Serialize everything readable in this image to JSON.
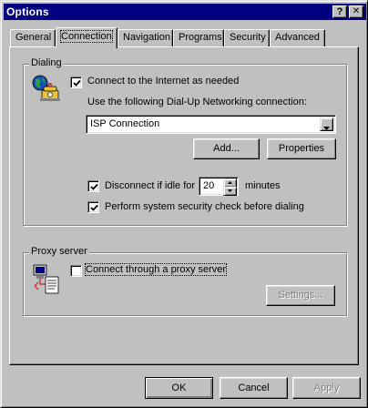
{
  "window": {
    "title": "Options",
    "help_label": "?",
    "close_label": "✕"
  },
  "tabs": [
    {
      "label": "General",
      "active": false
    },
    {
      "label": "Connection",
      "active": true
    },
    {
      "label": "Navigation",
      "active": false
    },
    {
      "label": "Programs",
      "active": false
    },
    {
      "label": "Security",
      "active": false
    },
    {
      "label": "Advanced",
      "active": false
    }
  ],
  "dialing": {
    "group_label": "Dialing",
    "icon": "phone-globe-icon",
    "connect_needed": {
      "label": "Connect to the Internet as needed",
      "checked": true
    },
    "use_dialup_label": "Use the following Dial-Up Networking connection:",
    "connection_value": "ISP Connection",
    "add_label": "Add...",
    "properties_label": "Properties",
    "disconnect": {
      "label": "Disconnect if idle for",
      "checked": true,
      "value": "20",
      "unit": "minutes"
    },
    "security_check": {
      "label": "Perform system security check before dialing",
      "checked": true
    }
  },
  "proxy": {
    "group_label": "Proxy server",
    "icon": "network-computer-icon",
    "connect_proxy": {
      "label": "Connect through a proxy server",
      "checked": false
    },
    "settings_label": "Settings..."
  },
  "footer": {
    "ok_label": "OK",
    "cancel_label": "Cancel",
    "apply_label": "Apply"
  },
  "colors": {
    "titlebar": "#000080",
    "face": "#c0c0c0"
  }
}
